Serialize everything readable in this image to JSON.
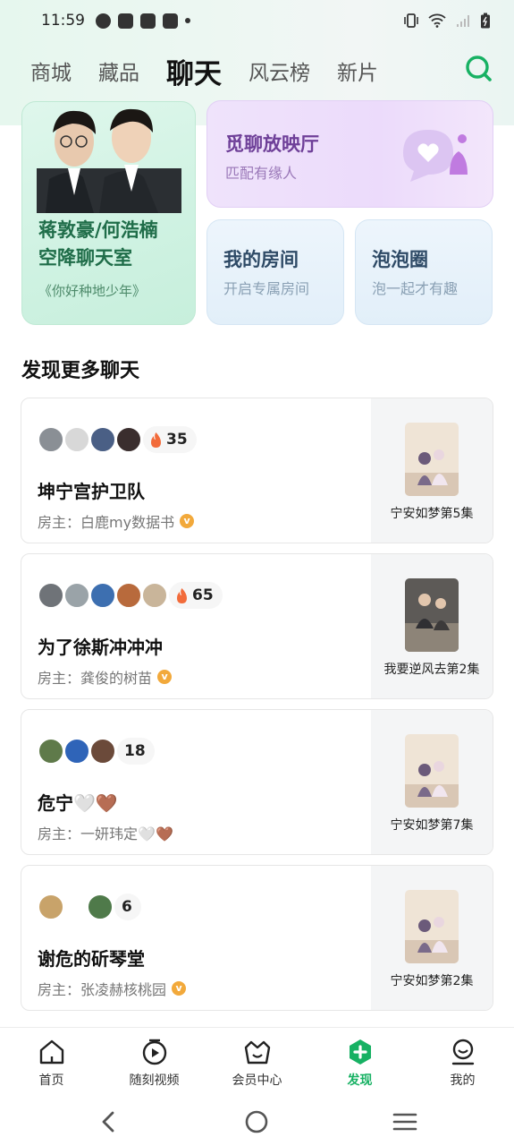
{
  "status_bar": {
    "time": "11:59"
  },
  "tabs": [
    {
      "label": "商城",
      "active": false
    },
    {
      "label": "藏品",
      "active": false
    },
    {
      "label": "聊天",
      "active": true
    },
    {
      "label": "风云榜",
      "active": false
    },
    {
      "label": "新片",
      "active": false
    }
  ],
  "feature_cards": {
    "star": {
      "title_line1": "蒋敦豪/何浩楠",
      "title_line2": "空降聊天室",
      "subtitle": "《你好种地少年》"
    },
    "cinema": {
      "title": "觅聊放映厅",
      "subtitle": "匹配有缘人"
    },
    "my_room": {
      "title": "我的房间",
      "subtitle": "开启专属房间"
    },
    "bubble": {
      "title": "泡泡圈",
      "subtitle": "泡一起才有趣"
    }
  },
  "section_title": "发现更多聊天",
  "rooms": [
    {
      "name": "坤宁宫护卫队",
      "host_label": "房主：",
      "host": "白鹿my数据书",
      "verified": true,
      "count": "35",
      "hot": true,
      "episode": "宁安如梦第5集",
      "avatar_colors": [
        "#8a8f95",
        "#d8d8d8",
        "#4a5f85",
        "#3a2e2e"
      ]
    },
    {
      "name": "为了徐斯冲冲冲",
      "host_label": "房主：",
      "host": "龚俊的树苗",
      "verified": true,
      "count": "65",
      "hot": true,
      "episode": "我要逆风去第2集",
      "avatar_colors": [
        "#6f7378",
        "#9aa3a8",
        "#3d6fb0",
        "#b86a3c",
        "#c9b59a"
      ]
    },
    {
      "name": "危宁🤍🤎",
      "host_label": "房主：",
      "host": "一妍玮定🤍🤎",
      "verified": false,
      "count": "18",
      "hot": false,
      "episode": "宁安如梦第7集",
      "avatar_colors": [
        "#5f7a4a",
        "#2f64b8",
        "#6b4a3a"
      ]
    },
    {
      "name": "谢危的斫琴堂",
      "host_label": "房主：",
      "host": "张凌赫核桃园",
      "verified": true,
      "count": "6",
      "hot": false,
      "episode": "宁安如梦第2集",
      "avatar_colors": [
        "#c8a36a",
        "#4f7a4a"
      ]
    }
  ],
  "bottom_nav": [
    {
      "label": "首页",
      "icon": "home-icon",
      "active": false
    },
    {
      "label": "随刻视频",
      "icon": "play-clock-icon",
      "active": false
    },
    {
      "label": "会员中心",
      "icon": "crown-basket-icon",
      "active": false
    },
    {
      "label": "发现",
      "icon": "discover-plus-icon",
      "active": true
    },
    {
      "label": "我的",
      "icon": "profile-icon",
      "active": false
    }
  ],
  "colors": {
    "accent": "#17b163",
    "star_title": "#1f6d49",
    "cinema_title": "#6e3f98",
    "verified": "#f2a93b"
  }
}
